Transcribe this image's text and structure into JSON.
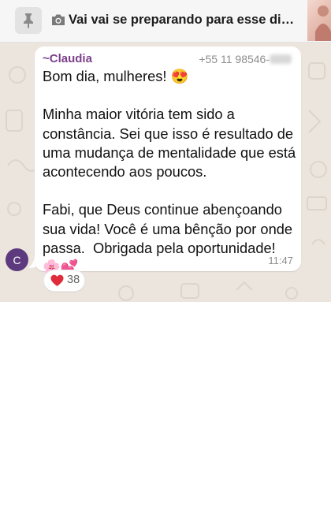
{
  "pinned": {
    "icon": "pin-icon",
    "media_icon": "camera-icon",
    "text": "Vai vai se preparando para esse dia e..."
  },
  "message": {
    "sender_name": "~Claudia",
    "sender_phone": "+55 11 98546-",
    "text": "Bom dia, mulheres! 😍\n\nMinha maior vitória tem sido a constância. Sei que isso é resultado de uma mudança de mentalidade que está acontecendo aos poucos.\n\nFabi, que Deus continue abençoando sua vida! Você é uma bênção por onde passa.  Obrigada pela oportunidade! 🌸💕",
    "time": "11:47"
  },
  "avatar": {
    "initial": "C",
    "color": "#5d3a7d"
  },
  "reaction": {
    "emoji_icon": "heart-icon",
    "count": "38"
  },
  "colors": {
    "chat_background": "#ece5dd",
    "sender_name": "#7c3f8a",
    "bubble": "#ffffff"
  }
}
